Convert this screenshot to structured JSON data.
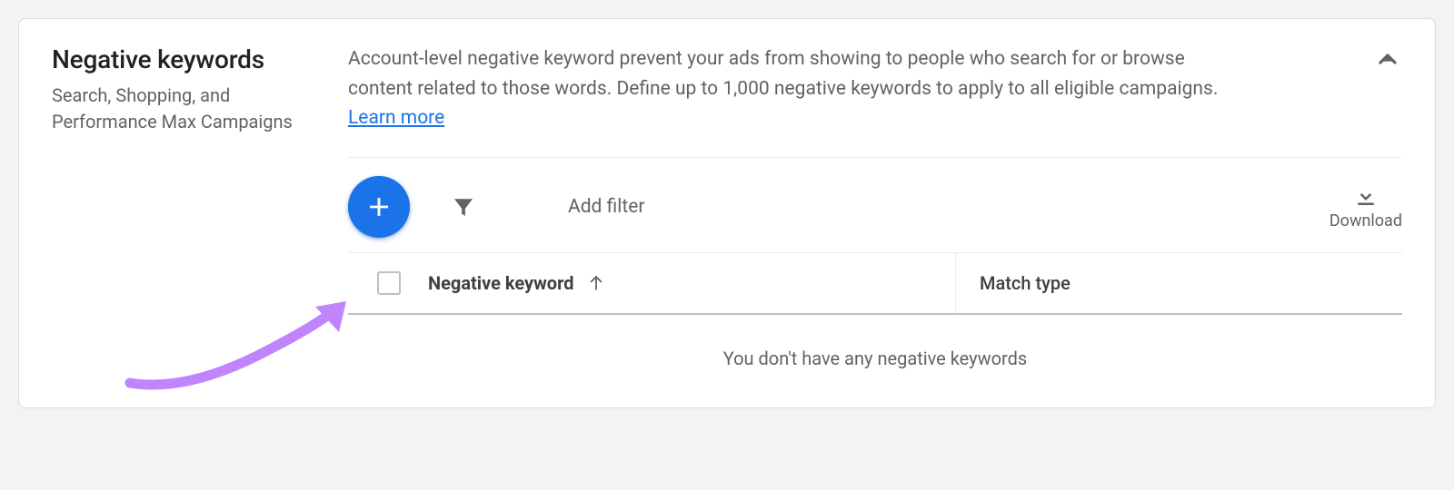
{
  "section": {
    "title": "Negative keywords",
    "subtitle": "Search, Shopping, and Performance Max Campaigns",
    "description": "Account-level negative keyword prevent your ads from showing to people who search for or browse content related to those words. Define up to 1,000 negative keywords to apply to all eligible campaigns. ",
    "learn_more": "Learn more"
  },
  "toolbar": {
    "add_filter_label": "Add filter",
    "download_label": "Download"
  },
  "table": {
    "columns": {
      "keyword": "Negative keyword",
      "match_type": "Match type"
    },
    "empty_message": "You don't have any negative keywords"
  },
  "colors": {
    "accent": "#1a73e8",
    "annotation": "#c084fc"
  }
}
